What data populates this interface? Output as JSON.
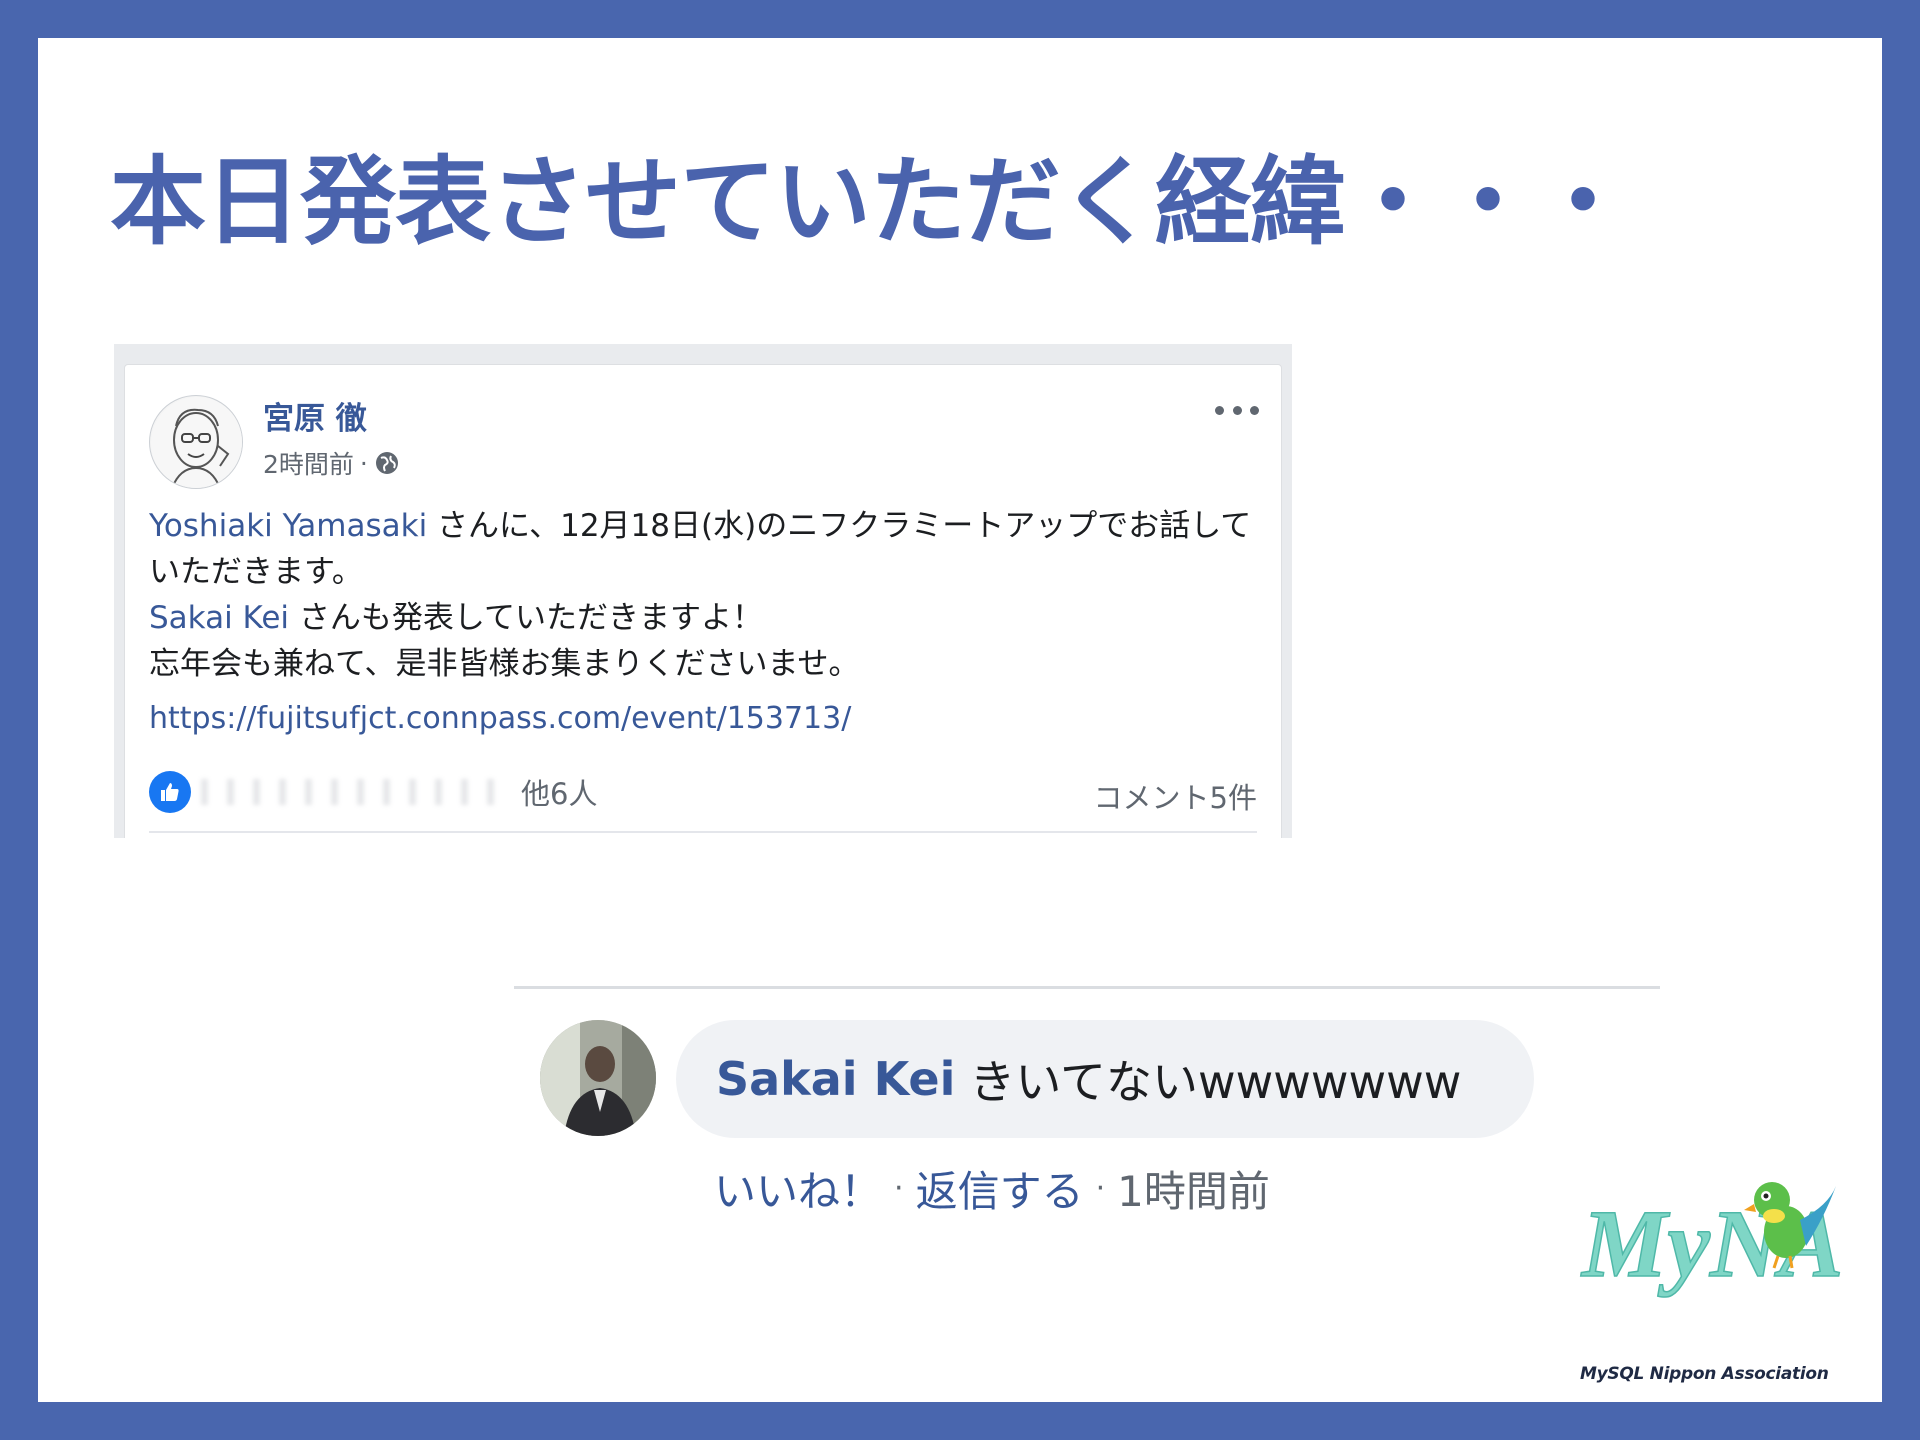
{
  "slide": {
    "title": "本日発表させていただく経緯・・・"
  },
  "post": {
    "author": "宮原 徹",
    "time": "2時間前",
    "meta_separator": "·",
    "body": {
      "mention1": "Yoshiaki Yamasaki",
      "line1_rest": " さんに、12月18日(水)のニフクラミートアップでお話していただきます。",
      "mention2": "Sakai Kei",
      "line2_rest": " さんも発表していただきますよ！",
      "line3": "忘年会も兼ねて、是非皆様お集まりくださいませ。"
    },
    "link": "https://fujitsufjct.connpass.com/event/153713/",
    "reactions_suffix": "他6人",
    "comment_count": "コメント5件"
  },
  "comment": {
    "author": "Sakai Kei",
    "text": "きいてないwwwwwww",
    "like_label": "いいね！",
    "reply_label": "返信する",
    "separator": "·",
    "time": "1時間前"
  },
  "logo": {
    "text": "MyNA",
    "tagline": "MySQL Nippon Association"
  },
  "colors": {
    "background": "#4966ae",
    "title": "#4a63ad",
    "link": "#385898",
    "like_blue": "#1877f2"
  },
  "icons": {
    "globe": "globe-icon",
    "more": "more-options-icon",
    "like": "thumbs-up-icon"
  }
}
